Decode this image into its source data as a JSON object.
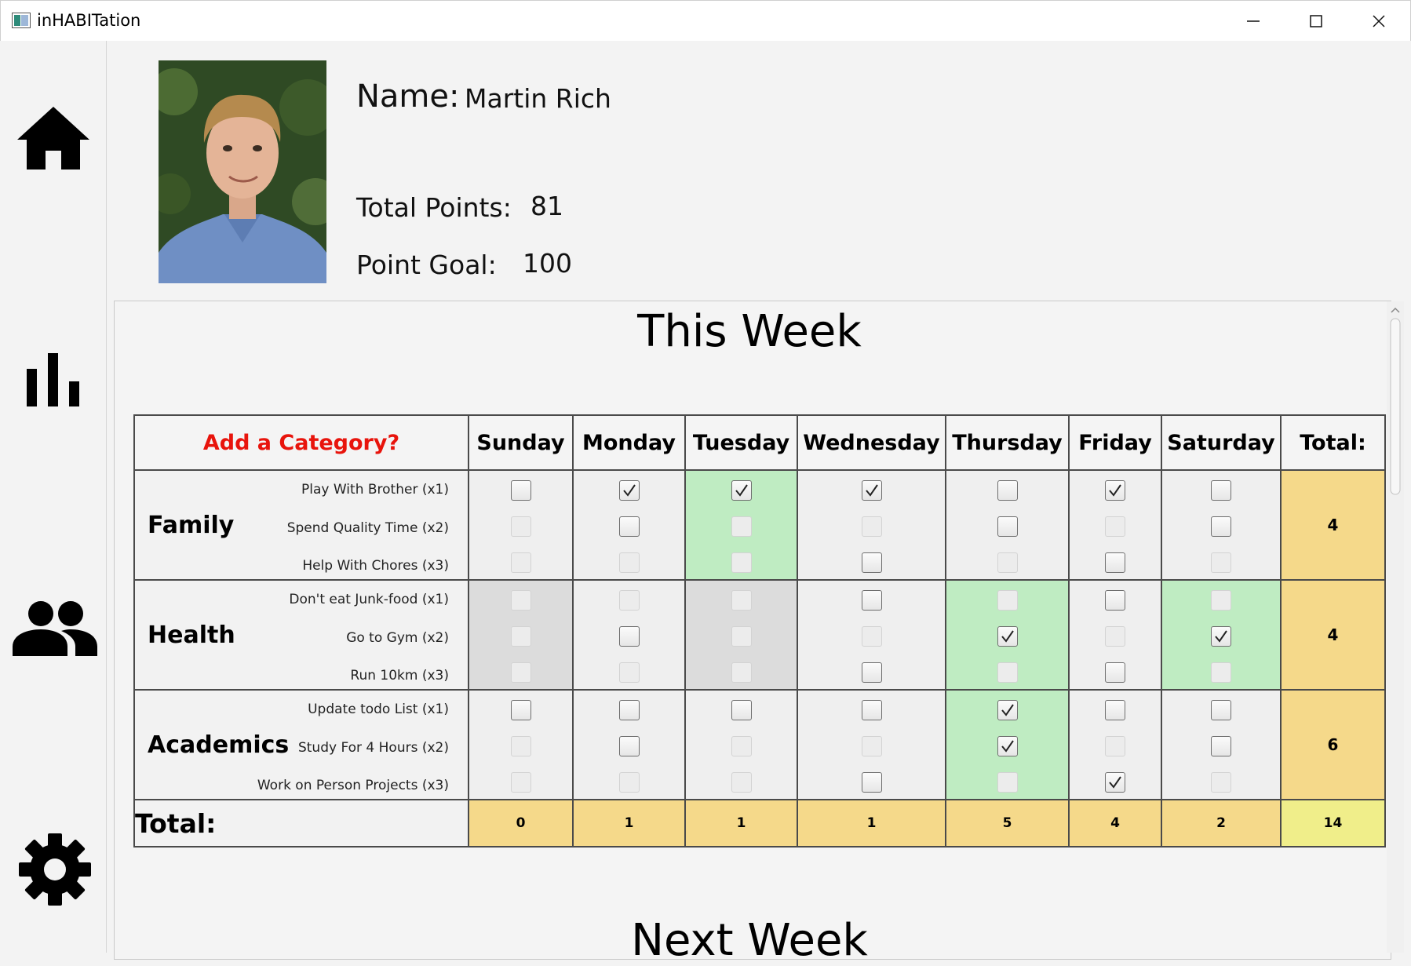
{
  "window": {
    "title": "inHABITation"
  },
  "sidebar": {
    "items": [
      {
        "name": "home-icon"
      },
      {
        "name": "bar-chart-icon"
      },
      {
        "name": "people-icon"
      },
      {
        "name": "settings-icon"
      }
    ]
  },
  "profile": {
    "name_label": "Name:",
    "name_value": "Martin Rich",
    "points_label": "Total Points:",
    "points_value": "81",
    "goal_label": "Point Goal:",
    "goal_value": "100"
  },
  "this_week": {
    "title": "This Week",
    "add_category": "Add a Category?",
    "days": [
      "Sunday",
      "Monday",
      "Tuesday",
      "Wednesday",
      "Thursday",
      "Friday",
      "Saturday"
    ],
    "total_label": "Total:",
    "categories": [
      {
        "name": "Family",
        "habits": [
          "Play With Brother (x1)",
          "Spend Quality Time (x2)",
          "Help With Chores (x3)"
        ],
        "cells": [
          {
            "bg": "",
            "states": [
              "on",
              "dim",
              "dim"
            ]
          },
          {
            "bg": "",
            "states": [
              "checked",
              "on",
              "dim"
            ]
          },
          {
            "bg": "green",
            "states": [
              "checked",
              "dim",
              "dim"
            ]
          },
          {
            "bg": "",
            "states": [
              "checked",
              "dim",
              "on"
            ]
          },
          {
            "bg": "",
            "states": [
              "on",
              "on",
              "dim"
            ]
          },
          {
            "bg": "",
            "states": [
              "checked",
              "dim",
              "on"
            ]
          },
          {
            "bg": "",
            "states": [
              "on",
              "on",
              "dim"
            ]
          }
        ],
        "total": "4"
      },
      {
        "name": "Health",
        "habits": [
          "Don't eat Junk-food (x1)",
          "Go to Gym (x2)",
          "Run 10km (x3)"
        ],
        "cells": [
          {
            "bg": "gray",
            "states": [
              "dim",
              "dim",
              "dim"
            ]
          },
          {
            "bg": "",
            "states": [
              "dim",
              "on",
              "dim"
            ]
          },
          {
            "bg": "gray",
            "states": [
              "dim",
              "dim",
              "dim"
            ]
          },
          {
            "bg": "",
            "states": [
              "on",
              "dim",
              "on"
            ]
          },
          {
            "bg": "green",
            "states": [
              "dim",
              "checked",
              "dim"
            ]
          },
          {
            "bg": "",
            "states": [
              "on",
              "dim",
              "on"
            ]
          },
          {
            "bg": "green",
            "states": [
              "dim",
              "checked",
              "dim"
            ]
          }
        ],
        "total": "4"
      },
      {
        "name": "Academics",
        "habits": [
          "Update todo List (x1)",
          "Study For 4 Hours (x2)",
          "Work on Person Projects (x3)"
        ],
        "cells": [
          {
            "bg": "",
            "states": [
              "on",
              "dim",
              "dim"
            ]
          },
          {
            "bg": "",
            "states": [
              "on",
              "on",
              "dim"
            ]
          },
          {
            "bg": "",
            "states": [
              "on",
              "dim",
              "dim"
            ]
          },
          {
            "bg": "",
            "states": [
              "on",
              "dim",
              "on"
            ]
          },
          {
            "bg": "green",
            "states": [
              "checked",
              "checked",
              "dim"
            ]
          },
          {
            "bg": "",
            "states": [
              "on",
              "dim",
              "checked"
            ]
          },
          {
            "bg": "",
            "states": [
              "on",
              "on",
              "dim"
            ]
          }
        ],
        "total": "6"
      }
    ],
    "day_totals": [
      "0",
      "1",
      "1",
      "1",
      "5",
      "4",
      "2"
    ],
    "grand_total": "14"
  },
  "next_week": {
    "title": "Next Week"
  },
  "colors": {
    "green": "#bfecc2",
    "gray": "#dcdcdc",
    "total": "#f5d98a",
    "grand_total": "#f0ee8a",
    "accent": "#e8140c"
  }
}
